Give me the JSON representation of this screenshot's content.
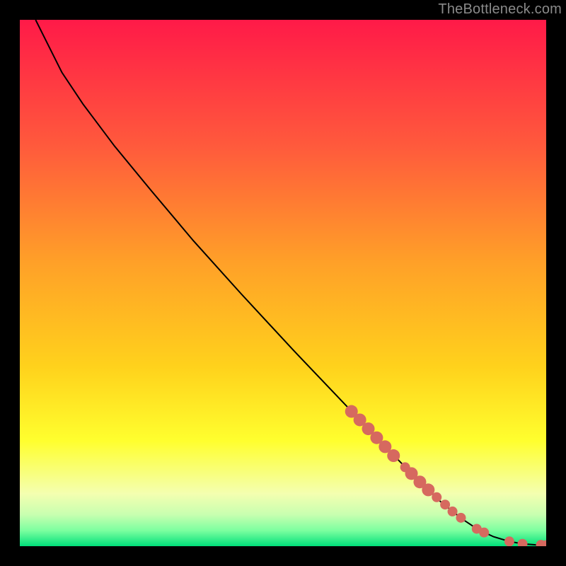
{
  "watermark": "TheBottleneck.com",
  "chart_data": {
    "type": "line",
    "title": "",
    "xlabel": "",
    "ylabel": "",
    "xlim": [
      0,
      100
    ],
    "ylim": [
      0,
      100
    ],
    "grid": false,
    "legend": false,
    "background_gradient": {
      "stops": [
        {
          "offset": 0.0,
          "color": "#ff1a48"
        },
        {
          "offset": 0.24,
          "color": "#ff5a3c"
        },
        {
          "offset": 0.46,
          "color": "#ffa028"
        },
        {
          "offset": 0.66,
          "color": "#ffd21c"
        },
        {
          "offset": 0.8,
          "color": "#ffff2e"
        },
        {
          "offset": 0.9,
          "color": "#f4ffb0"
        },
        {
          "offset": 0.94,
          "color": "#c8ffb0"
        },
        {
          "offset": 0.97,
          "color": "#7dffa0"
        },
        {
          "offset": 1.0,
          "color": "#00e07a"
        }
      ]
    },
    "series": [
      {
        "name": "curve",
        "type": "line",
        "color": "#000000",
        "x": [
          3,
          5,
          8,
          12,
          18,
          25,
          33,
          42,
          52,
          60,
          68,
          75,
          80,
          84,
          87,
          90,
          93,
          95.5,
          98,
          100
        ],
        "y": [
          100,
          96,
          90,
          84,
          76,
          67.5,
          58,
          48,
          37.2,
          28.8,
          20.4,
          13.2,
          8.4,
          5.2,
          3.2,
          1.8,
          0.9,
          0.45,
          0.25,
          0.2
        ]
      },
      {
        "name": "markers",
        "type": "scatter",
        "color": "#d6695f",
        "radius_major": 9,
        "radius_minor": 7,
        "points": [
          {
            "x": 63.0,
            "y": 25.6,
            "r": "major"
          },
          {
            "x": 64.6,
            "y": 24.0,
            "r": "major"
          },
          {
            "x": 66.2,
            "y": 22.3,
            "r": "major"
          },
          {
            "x": 67.8,
            "y": 20.6,
            "r": "major"
          },
          {
            "x": 69.4,
            "y": 18.9,
            "r": "major"
          },
          {
            "x": 71.0,
            "y": 17.2,
            "r": "major"
          },
          {
            "x": 73.2,
            "y": 15.0,
            "r": "minor"
          },
          {
            "x": 74.4,
            "y": 13.8,
            "r": "major"
          },
          {
            "x": 76.0,
            "y": 12.2,
            "r": "major"
          },
          {
            "x": 77.6,
            "y": 10.7,
            "r": "major"
          },
          {
            "x": 79.2,
            "y": 9.3,
            "r": "minor"
          },
          {
            "x": 80.8,
            "y": 7.9,
            "r": "minor"
          },
          {
            "x": 82.2,
            "y": 6.6,
            "r": "minor"
          },
          {
            "x": 83.8,
            "y": 5.4,
            "r": "minor"
          },
          {
            "x": 86.8,
            "y": 3.3,
            "r": "minor"
          },
          {
            "x": 88.2,
            "y": 2.6,
            "r": "minor"
          },
          {
            "x": 93.0,
            "y": 0.9,
            "r": "minor"
          },
          {
            "x": 95.5,
            "y": 0.45,
            "r": "minor"
          },
          {
            "x": 99.0,
            "y": 0.25,
            "r": "minor"
          },
          {
            "x": 100.0,
            "y": 0.2,
            "r": "minor"
          }
        ]
      }
    ]
  }
}
